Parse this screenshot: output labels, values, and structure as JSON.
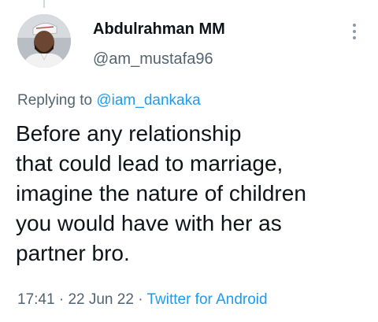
{
  "user": {
    "name": "Abdulrahman MM",
    "handle": "@am_mustafa96"
  },
  "reply": {
    "prefix": "Replying to",
    "mention": "@iam_dankaka"
  },
  "tweet": {
    "lines": [
      "Before any relationship",
      "that could lead to marriage,",
      "imagine the nature of children",
      "you would have with her as",
      "partner bro."
    ]
  },
  "meta": {
    "time": "17:41",
    "date": "22 Jun 22",
    "source": "Twitter for Android",
    "separator": "·"
  },
  "icons": {
    "more": "more-vertical-icon"
  },
  "colors": {
    "text": "#0f1419",
    "secondary": "#536471",
    "link": "#1d9bf0"
  }
}
